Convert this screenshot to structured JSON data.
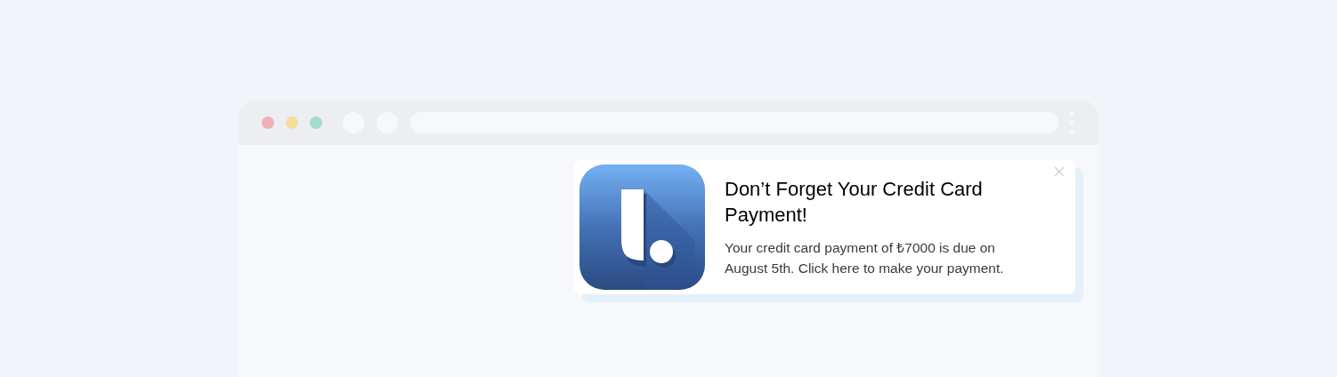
{
  "notification": {
    "title": "Don’t Forget Your Credit Card Payment!",
    "message": "Your credit card payment of ₺7000 is due on August 5th. Click here to make your payment."
  }
}
